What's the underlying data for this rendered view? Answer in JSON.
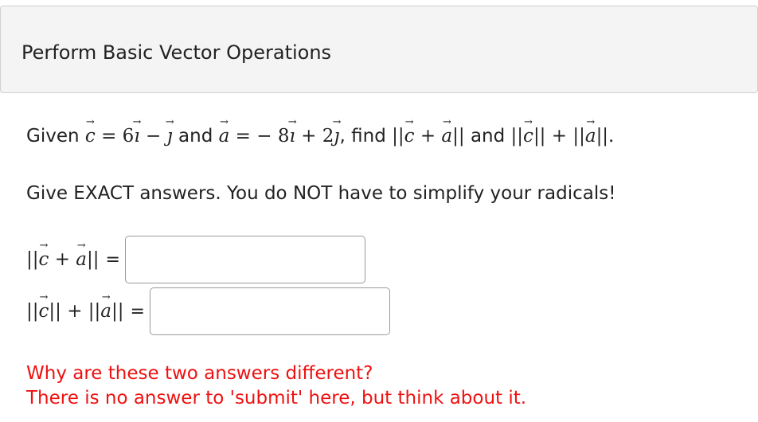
{
  "header": {
    "title": "Perform Basic Vector Operations"
  },
  "problem": {
    "given": "Given",
    "c_sym": "c",
    "eq": "=",
    "c_expr_1": "6",
    "i_sym": "ı",
    "minus": "−",
    "j_sym": "ȷ",
    "and1": "and",
    "a_sym": "a",
    "a_expr_1": "− 8",
    "plus": "+",
    "a_expr_2": "2",
    "find": ", find",
    "and2": "and"
  },
  "instruction": "Give EXACT answers. You do NOT have to simplify your radicals!",
  "answers": {
    "field1_value": "",
    "field2_value": "",
    "equals": "="
  },
  "notes": {
    "line1": "Why are these two answers different?",
    "line2": "There is no answer to 'submit' here, but think about it."
  }
}
